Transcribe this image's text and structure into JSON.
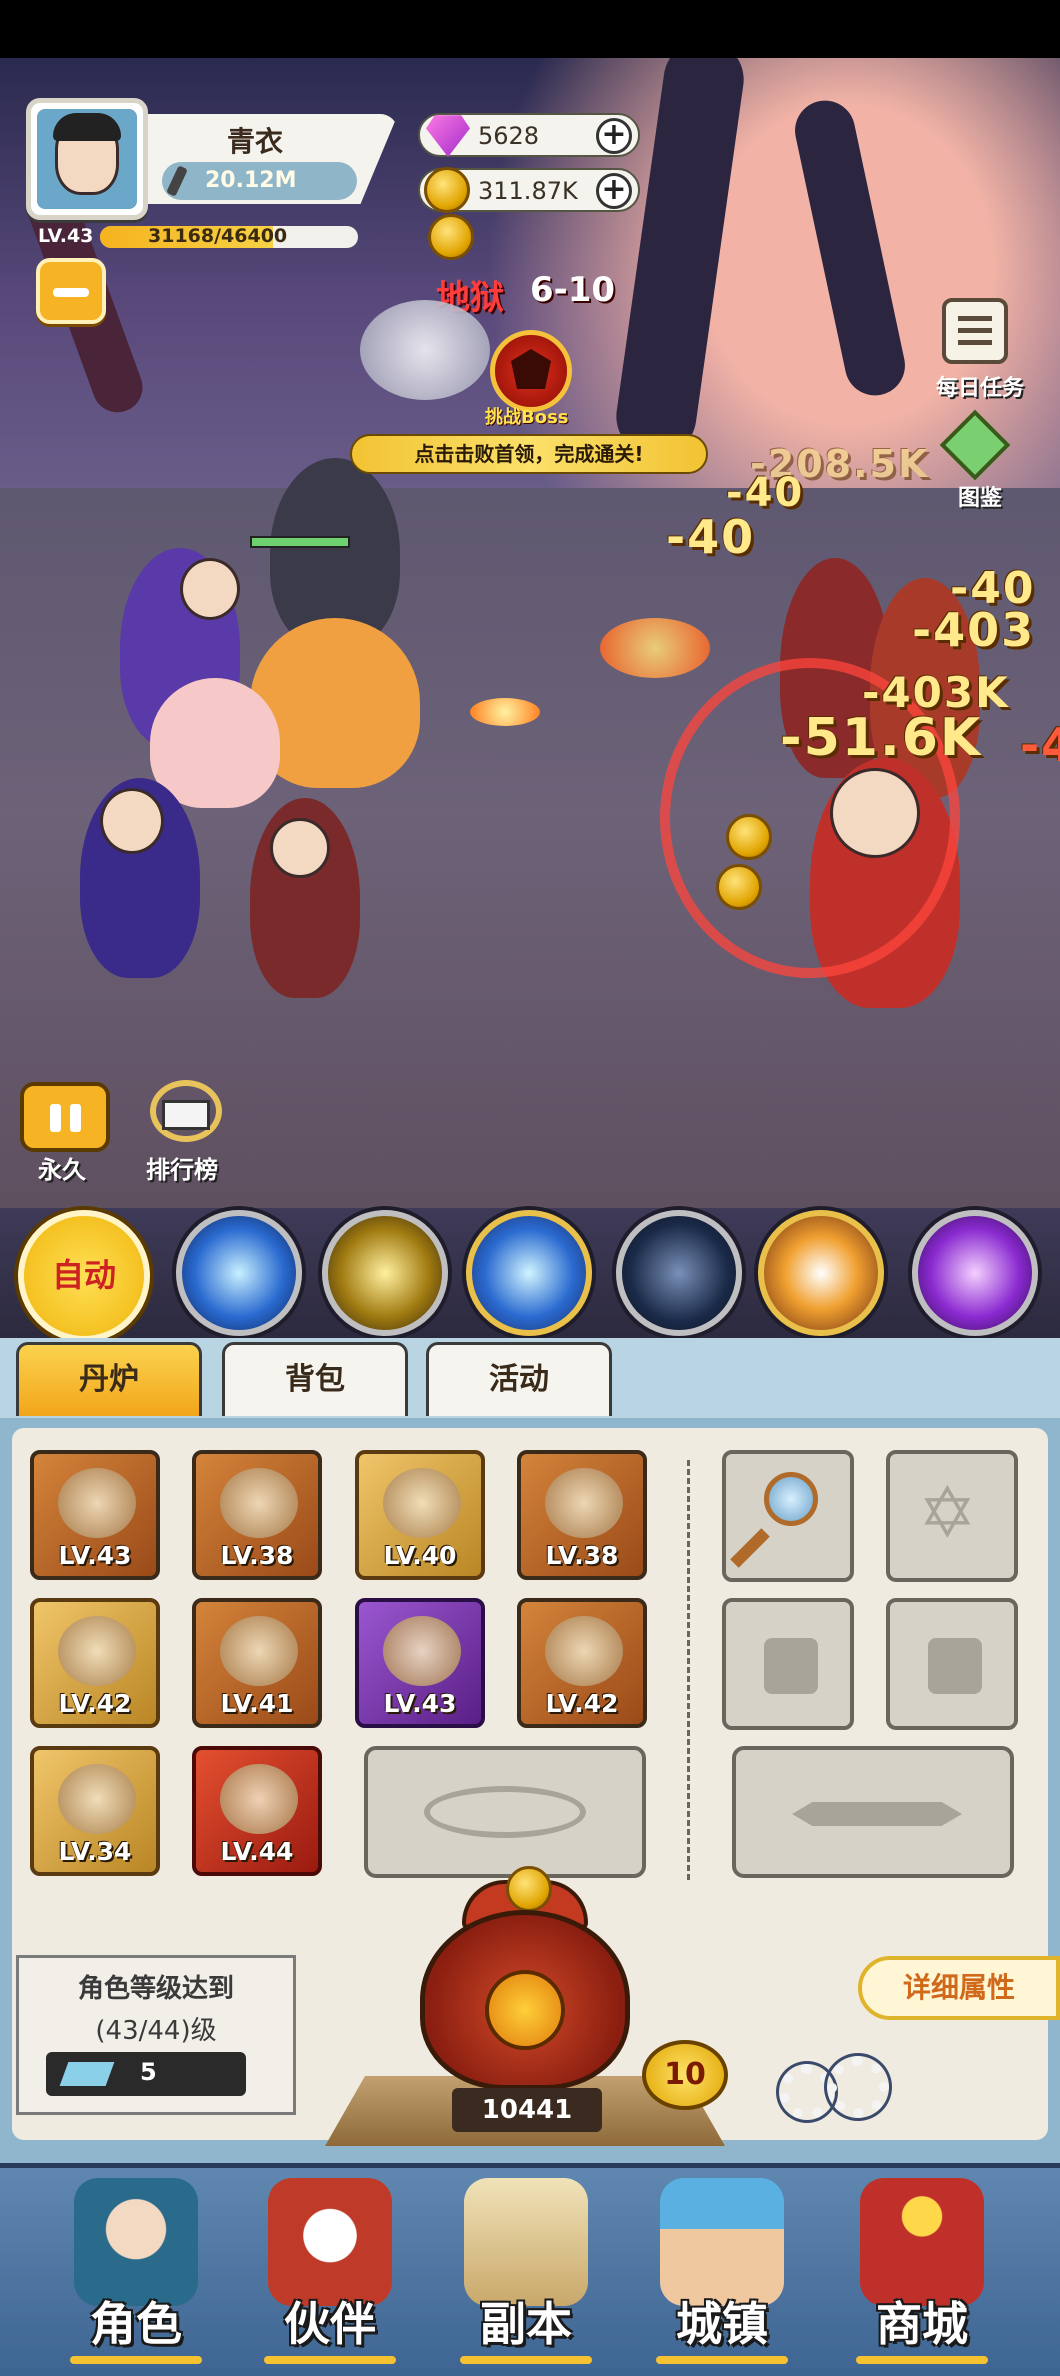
{
  "player": {
    "name": "青衣",
    "power": "20.12M",
    "level": "LV.43",
    "exp": "31168/46400",
    "exp_fraction": 0.672
  },
  "currency": {
    "gems": "5628",
    "coins": "311.87K"
  },
  "stage": {
    "name": "地狱",
    "number": "6-10",
    "boss_label": "挑战Boss",
    "boss_hint": "点击击败首领，完成通关!"
  },
  "side_buttons": {
    "daily_task": "每日任务",
    "codex": "图鉴",
    "pause": "永久",
    "ranking": "排行榜"
  },
  "damage_numbers": [
    "-208.5K",
    "-40",
    "-403",
    "-403K",
    "-51.6K",
    "-4"
  ],
  "skills": {
    "auto_label": "自动",
    "icons": [
      "lightning-skill-icon",
      "golden-swords-skill-icon",
      "blue-comet-skill-icon",
      "dark-rune-skill-icon",
      "whirlwind-skill-icon",
      "purple-orb-skill-icon"
    ]
  },
  "tabs": [
    "丹炉",
    "背包",
    "活动"
  ],
  "equipment": [
    {
      "level": "LV.43",
      "icon": "spear-icon",
      "rarity": "orange"
    },
    {
      "level": "LV.38",
      "icon": "helmet-icon",
      "rarity": "orange"
    },
    {
      "level": "LV.40",
      "icon": "robe-icon",
      "rarity": "gold"
    },
    {
      "level": "LV.38",
      "icon": "orb-icon",
      "rarity": "orange"
    },
    {
      "level": "LV.42",
      "icon": "fan-icon",
      "rarity": "orange"
    },
    {
      "level": "LV.41",
      "icon": "shield-icon",
      "rarity": "orange"
    },
    {
      "level": "LV.43",
      "icon": "gourd-icon",
      "rarity": "purple"
    },
    {
      "level": "LV.42",
      "icon": "pearl-icon",
      "rarity": "orange"
    },
    {
      "level": "LV.34",
      "icon": "belt-icon",
      "rarity": "gold"
    },
    {
      "level": "LV.44",
      "icon": "boots-icon",
      "rarity": "red"
    }
  ],
  "requirement": {
    "title": "角色等级达到",
    "level": "(43/44)级",
    "cost": "5"
  },
  "furnace": {
    "counter": "10441",
    "badge_level": "10",
    "detail_label": "详细属性"
  },
  "nav": [
    "角色",
    "伙伴",
    "副本",
    "城镇",
    "商城"
  ],
  "colors": {
    "accent_gold": "#f6b323",
    "panel_blue": "#8fb6cc",
    "nav_blue": "#4f79a6"
  }
}
